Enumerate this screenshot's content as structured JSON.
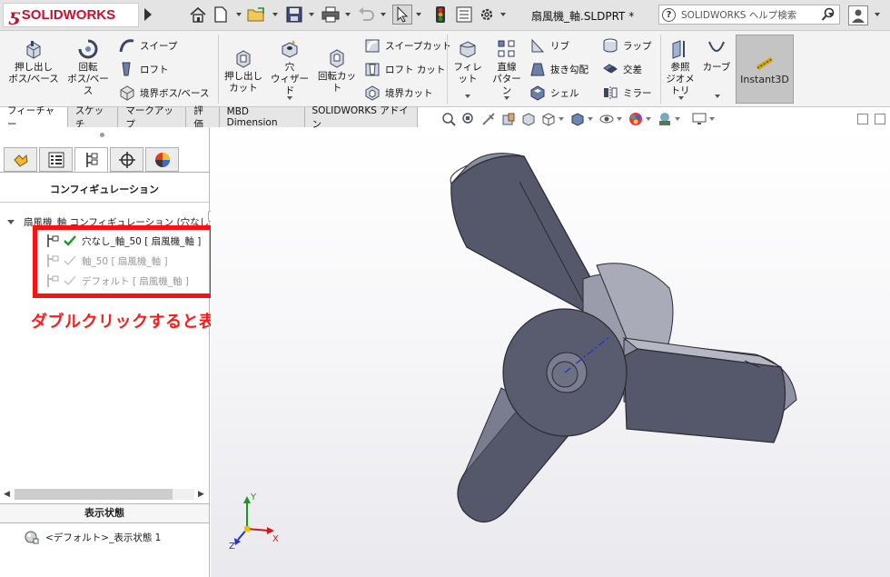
{
  "app": {
    "brand": "SOLIDWORKS",
    "document_title": "扇風機_軸.SLDPRT *",
    "help_search_placeholder": "SOLIDWORKS ヘルプ検索"
  },
  "ribbon": {
    "extrude_boss": "押し出し\nボス/ベース",
    "revolve_boss": "回転\nボス/ベース",
    "sweep": "スイープ",
    "loft": "ロフト",
    "boundary_boss": "境界ボス/ベース",
    "extrude_cut": "押し出し\nカット",
    "hole_wizard": "穴\nウィザード",
    "revolve_cut": "回転カット",
    "swept_cut": "スイープカット",
    "lofted_cut": "ロフト カット",
    "boundary_cut": "境界カット",
    "fillet": "フィレット",
    "linear_pattern": "直線\nパターン",
    "rib": "リブ",
    "draft": "抜き勾配",
    "shell": "シェル",
    "wrap": "ラップ",
    "intersect": "交差",
    "mirror": "ミラー",
    "reference_geometry": "参照\nジオメトリ",
    "curves": "カーブ",
    "instant3d": "Instant3D"
  },
  "command_tabs": [
    "フィーチャー",
    "スケッチ",
    "マークアップ",
    "評価",
    "MBD Dimension",
    "SOLIDWORKS アドイン"
  ],
  "panel": {
    "config_header": "コンフィギュレーション",
    "root_label": "扇風機_軸 コンフィギュレーション (穴なし_軸",
    "configs": [
      {
        "label": "穴なし_軸_50 [ 扇風機_軸 ]",
        "active": true
      },
      {
        "label": "軸_50 [ 扇風機_軸 ]",
        "active": false
      },
      {
        "label": "デフォルト [ 扇風機_軸 ]",
        "active": false
      }
    ],
    "annotation": "ダブルクリックすると表示が変わる",
    "display_states_header": "表示状態",
    "display_state_item": "<デフォルト>_表示状態 1"
  },
  "triad": {
    "x": "X",
    "y": "Y",
    "z": "Z"
  },
  "colors": {
    "brand_red": "#c8102e",
    "annotation_red": "#ff1010",
    "model_face": "#55586a"
  }
}
